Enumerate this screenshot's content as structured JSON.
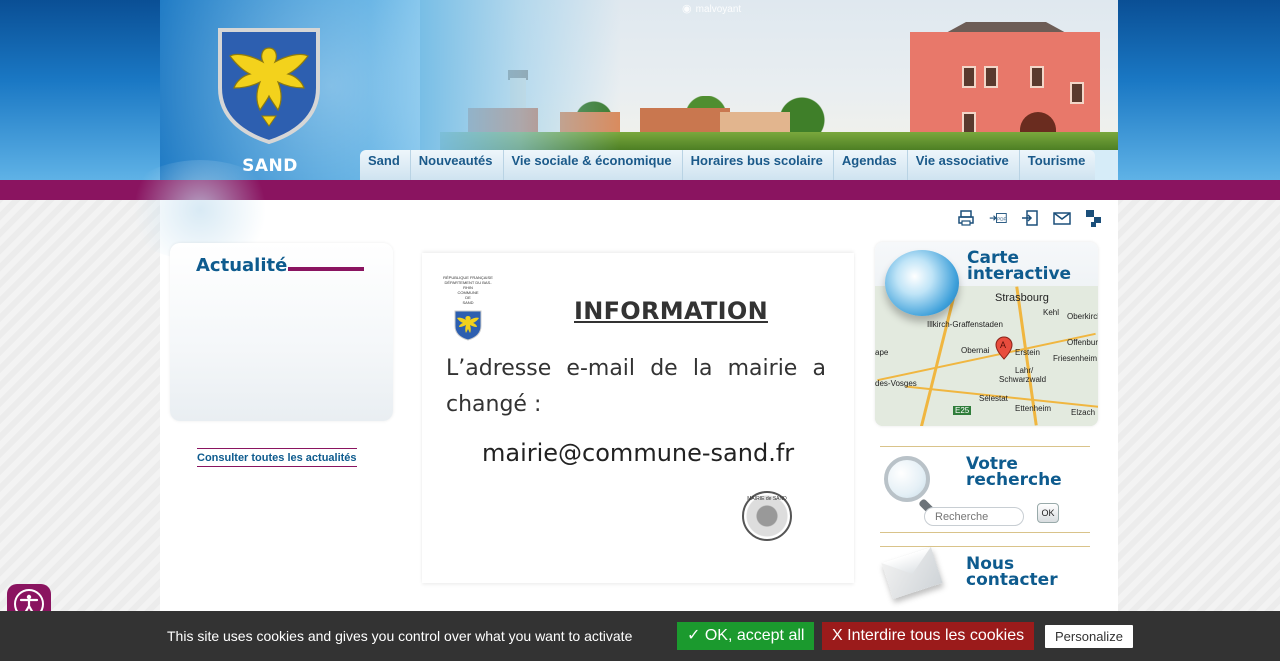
{
  "header": {
    "town_name": "SAND",
    "malvoyant_label": "malvoyant"
  },
  "nav": {
    "items": [
      {
        "label": "Sand"
      },
      {
        "label": "Nouveautés"
      },
      {
        "label": "Vie sociale & économique"
      },
      {
        "label": "Horaires bus scolaire"
      },
      {
        "label": "Agendas"
      },
      {
        "label": "Vie associative"
      },
      {
        "label": "Tourisme"
      }
    ]
  },
  "tools": {
    "icons": [
      "print-icon",
      "pdf-export-icon",
      "login-icon",
      "mail-icon",
      "sitemap-icon"
    ]
  },
  "actualite": {
    "title": "Actualité",
    "link_label": "Consulter toutes les actualités"
  },
  "info": {
    "logo_text": [
      "RÉPUBLIQUE FRANÇAISE",
      "DÉPARTEMENT DU BAS-RHIN",
      "COMMUNE",
      "DE",
      "SAND"
    ],
    "title": "INFORMATION",
    "body": "L’adresse e-mail de la mairie a changé :",
    "email": "mairie@commune-sand.fr",
    "stamp_text": "MAIRIE de SAND"
  },
  "map": {
    "title_line1": "Carte",
    "title_line2": "interactive",
    "labels": [
      "Strasbourg",
      "Kehl",
      "Illkirch-Graffenstaden",
      "Oberkirch",
      "Offenburg",
      "Obernai",
      "Erstein",
      "Friesenheim",
      "Lahr/",
      "Schwarzwald",
      "Sélestat",
      "Ettenheim",
      "Elzach",
      "des-Vosges",
      "ape",
      "E25"
    ],
    "marker": "A"
  },
  "search": {
    "title_line1": "Votre",
    "title_line2": "recherche",
    "placeholder": "Recherche",
    "button_label": "OK"
  },
  "contact": {
    "title_line1": "Nous",
    "title_line2": "contacter"
  },
  "cookie": {
    "message": "This site uses cookies and gives you control over what you want to activate",
    "accept_label": "✓ OK, accept all",
    "deny_label": "X Interdire tous les cookies",
    "personalize_label": "Personalize"
  },
  "colors": {
    "brand_purple": "#8a1460",
    "title_blue": "#0e5b8e",
    "accept_green": "#1b9a2e",
    "deny_red": "#9b1b1b"
  }
}
